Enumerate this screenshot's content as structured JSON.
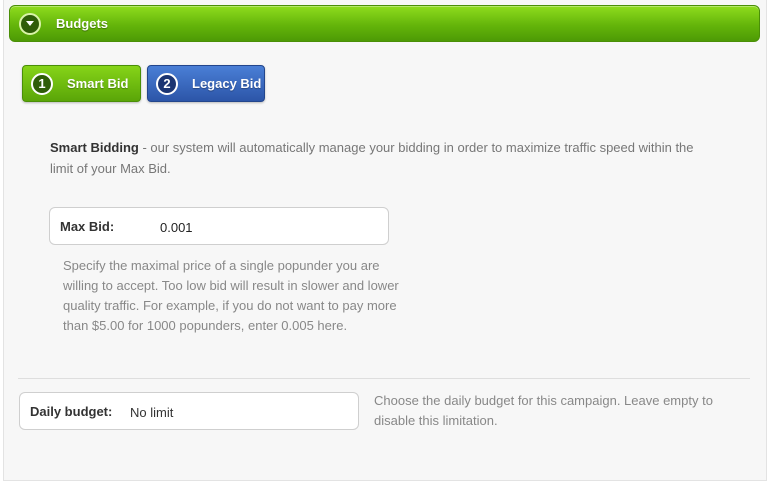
{
  "section": {
    "title": "Budgets",
    "toggle_icon": "chevron-down-icon"
  },
  "tabs": [
    {
      "number": "1",
      "label": "Smart Bid",
      "color": "#6bbf0e",
      "selected": true
    },
    {
      "number": "2",
      "label": "Legacy Bid",
      "color": "#3a6bc4",
      "selected": false
    }
  ],
  "smart_bidding": {
    "heading": "Smart Bidding",
    "description": " - our system will automatically manage your bidding in order to maximize traffic speed within the limit of your Max Bid."
  },
  "max_bid": {
    "label": "Max Bid:",
    "value": "0.001",
    "help": "Specify the maximal price of a single popunder you are willing to accept. Too low bid will result in slower and lower quality traffic. For example, if you do not want to pay more than $5.00 for 1000 popunders, enter 0.005 here."
  },
  "daily_budget": {
    "label": "Daily budget:",
    "placeholder": "No limit",
    "help": "Choose the daily budget for this campaign. Leave empty to disable this limitation."
  },
  "colors": {
    "header_green": "#64b50a",
    "tab_green": "#6bbf0e",
    "tab_blue": "#3a6bc4"
  }
}
